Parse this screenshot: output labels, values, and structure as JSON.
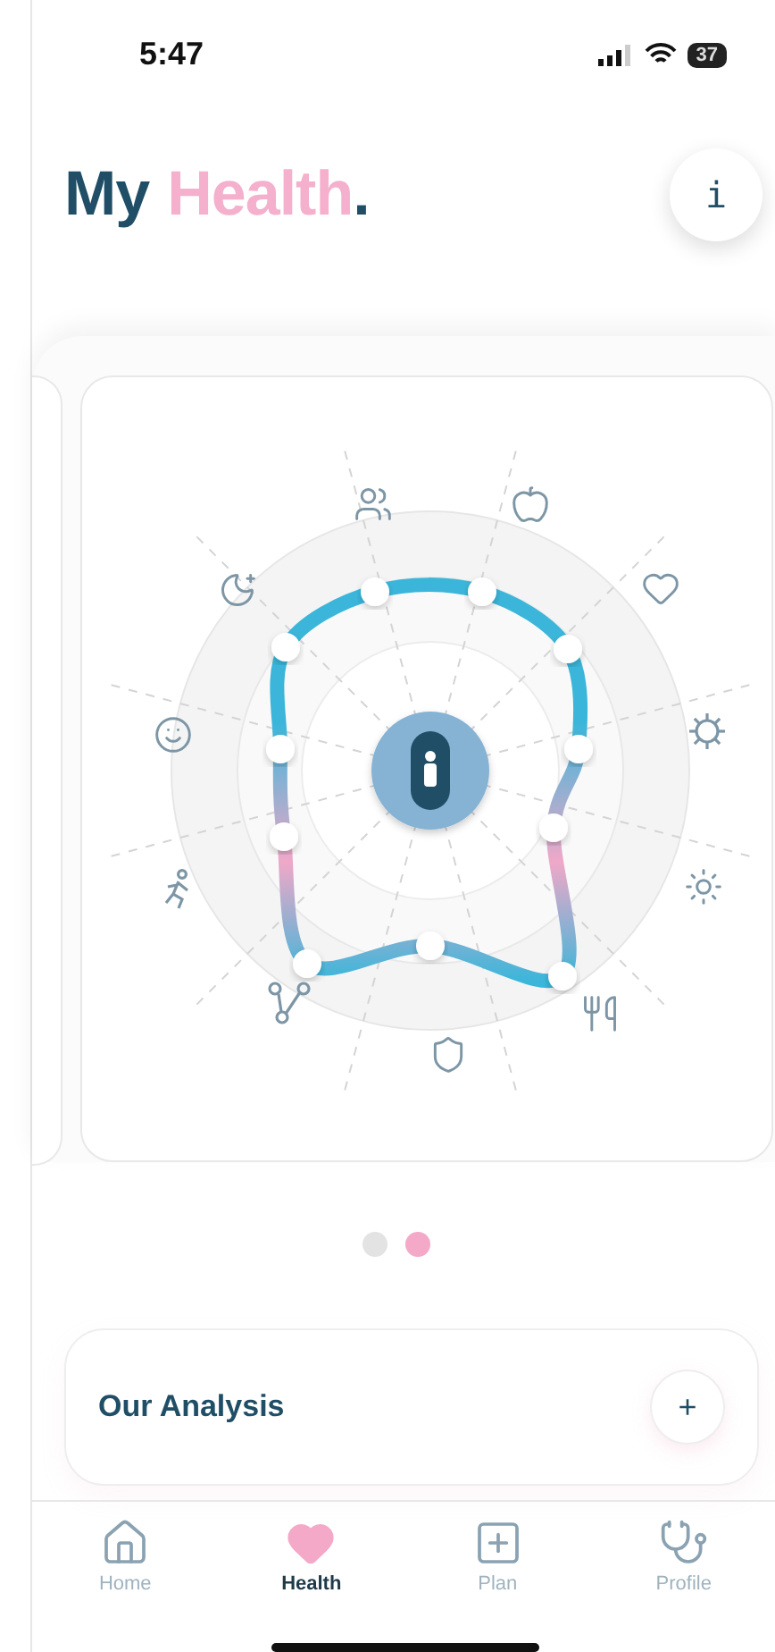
{
  "status_bar": {
    "time": "5:47",
    "battery": "37"
  },
  "title_parts": [
    {
      "kind": "plain",
      "text": "My"
    },
    {
      "kind": "accent",
      "text": "Health"
    },
    {
      "kind": "plain",
      "text": "."
    }
  ],
  "info_button": "i",
  "pager": [
    {
      "selected": false
    },
    {
      "selected": true
    }
  ],
  "analysis": {
    "title": "Our Analysis",
    "button": "+"
  },
  "nav": [
    {
      "kind": "home",
      "label": "Home",
      "selected": false
    },
    {
      "kind": "health",
      "label": "Health",
      "selected": true
    },
    {
      "kind": "plan",
      "label": "Plan",
      "selected": false
    },
    {
      "kind": "profile",
      "label": "Profile",
      "selected": false
    }
  ]
}
